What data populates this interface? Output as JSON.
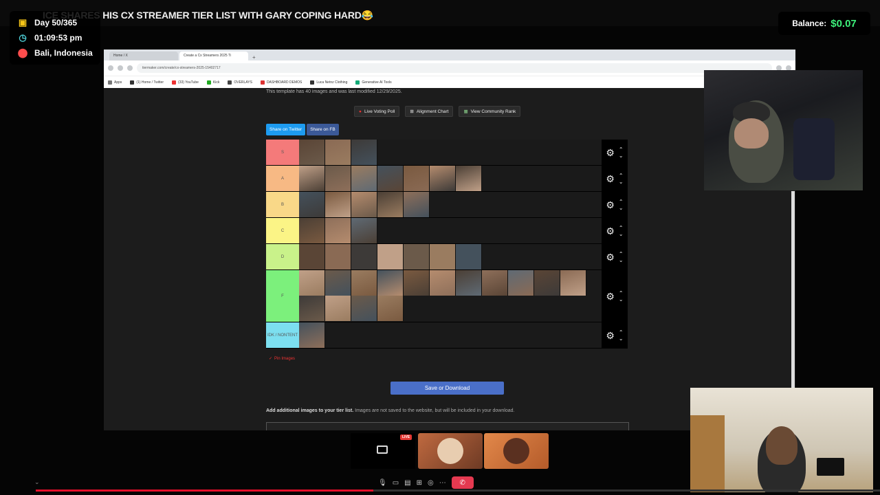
{
  "headline": "ICE SHARES HIS CX STREAMER TIER LIST WITH GARY COPING HARD😂",
  "info": {
    "day": "Day 50/365",
    "time": "01:09:53 pm",
    "location": "Bali, Indonesia",
    "icons": [
      "calendar-icon",
      "clock-icon",
      "location-pin-icon"
    ]
  },
  "balance": {
    "label": "Balance:",
    "value": "$0.07",
    "value_color": "#3df07a"
  },
  "browser": {
    "tabs": [
      "Home / X",
      "Create a Cx Streamers 2025 Ti"
    ],
    "url": "tiermaker.com/create/cx-streamers-2025-15402717",
    "bookmarks": [
      "Apps",
      "(1) Home / Twitter",
      "(33) YouTube",
      "Kick",
      "OVERLAYS",
      "DASHBOARD DEMOS",
      "Luca Netnz Clothing",
      "Generative AI Tools"
    ]
  },
  "tiermaker": {
    "template_note": "This template has 40 images and was last modified 12/29/2025.",
    "actions": [
      "Live Voting Poll",
      "Alignment Chart",
      "View Community Rank"
    ],
    "share_twitter": "Share on Twitter",
    "share_fb": "Share on FB",
    "tiers": [
      {
        "label": "S",
        "color": "#f47a7a",
        "count": 3,
        "rows": 1
      },
      {
        "label": "A",
        "color": "#f7b984",
        "count": 7,
        "rows": 1
      },
      {
        "label": "B",
        "color": "#f9d888",
        "count": 5,
        "rows": 1
      },
      {
        "label": "C",
        "color": "#fbf486",
        "count": 3,
        "rows": 1
      },
      {
        "label": "D",
        "color": "#c9f28a",
        "count": 7,
        "rows": 1
      },
      {
        "label": "F",
        "color": "#7cf07c",
        "count": 15,
        "rows": 2
      },
      {
        "label": "IDK / NONTENT",
        "color": "#7cdff0",
        "count": 1,
        "rows": 1
      }
    ],
    "pin_images": "Pin Images",
    "save_button": "Save or Download",
    "add_note_bold": "Add additional images to your tier list.",
    "add_note_rest": " Images are not saved to the website, but will be included in your download."
  },
  "meeting": {
    "live_label": "LIVE",
    "progress": 0.4
  }
}
